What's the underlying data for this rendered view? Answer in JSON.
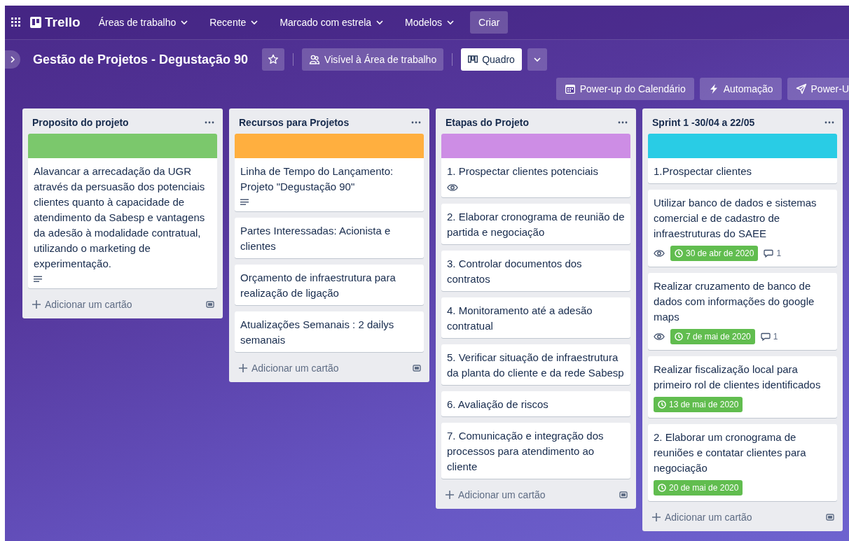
{
  "top_nav": {
    "app_name": "Trello",
    "menus": [
      {
        "label": "Áreas de trabalho"
      },
      {
        "label": "Recente"
      },
      {
        "label": "Marcado com estrela"
      },
      {
        "label": "Modelos"
      }
    ],
    "create_button": "Criar"
  },
  "board": {
    "title": "Gestão de Projetos - Degustação 90",
    "starred": false,
    "visibility": "Visível à Área de trabalho",
    "view": "Quadro"
  },
  "board_actions": [
    {
      "label": "Power-up do Calendário",
      "kind": "calendar"
    },
    {
      "label": "Automação",
      "kind": "automation"
    },
    {
      "label": "Power-U",
      "kind": "powerups"
    }
  ],
  "lists": [
    {
      "title": "Proposito do projeto",
      "add_card": "Adicionar um cartão",
      "cards": [
        {
          "color": "#7bc86c",
          "text": "Alavancar a arrecadação da UGR através da persuasão dos potenciais clientes quanto à capacidade de atendimento da Sabesp e vantagens da adesão à modalidade contratual, utilizando o marketing de experimentação.",
          "watching": false,
          "description": true
        }
      ]
    },
    {
      "title": "Recursos para Projetos",
      "add_card": "Adicionar um cartão",
      "cards": [
        {
          "color": "#ffaf3f",
          "text": "Linha de Tempo do Lançamento: Projeto \"Degustação 90\"",
          "watching": false,
          "description": true
        },
        {
          "text": "Partes Interessadas: Acionista e clientes",
          "watching": false,
          "description": false
        },
        {
          "text": "Orçamento de infraestrutura para realização de ligação",
          "watching": false,
          "description": false
        },
        {
          "text": "Atualizações Semanais : 2 dailys semanais",
          "watching": false,
          "description": false
        }
      ]
    },
    {
      "title": "Etapas do Projeto",
      "add_card": "Adicionar um cartão",
      "cards": [
        {
          "color": "#cd8de5",
          "text": "1. Prospectar clientes potenciais",
          "watching": true,
          "description": false
        },
        {
          "text": "2. Elaborar cronograma de reunião de partida e negociação",
          "watching": false,
          "description": false
        },
        {
          "text": "3. Controlar documentos dos contratos",
          "watching": false,
          "description": false
        },
        {
          "text": "4. Monitoramento até a adesão contratual",
          "watching": false,
          "description": false
        },
        {
          "text": "5. Verificar situação de infraestrutura da planta do cliente e da rede Sabesp",
          "watching": false,
          "description": false
        },
        {
          "text": "6. Avaliação de riscos",
          "watching": false,
          "description": false
        },
        {
          "text": "7. Comunicação e integração dos processos para atendimento ao cliente",
          "watching": false,
          "description": false
        }
      ]
    },
    {
      "title": "Sprint 1 -30/04 a 22/05",
      "add_card": "Adicionar um cartão",
      "cards": [
        {
          "color": "#29cce5",
          "text": "1.Prospectar clientes",
          "watching": false,
          "description": false
        },
        {
          "text": "Utilizar banco de dados e sistemas comercial e de cadastro de infraestruturas do SAEE",
          "watching": true,
          "description": false,
          "due": "30 de abr de 2020",
          "comments": "1"
        },
        {
          "text": "Realizar cruzamento de banco de dados com informações do google maps",
          "watching": true,
          "description": false,
          "due": "7 de mai de 2020",
          "comments": "1"
        },
        {
          "text": "Realizar fiscalização local para primeiro rol de clientes identificados",
          "watching": false,
          "description": false,
          "due": "13 de mai de 2020"
        },
        {
          "text": "2. Elaborar um cronograma de reuniões e contatar clientes para negociação",
          "watching": false,
          "description": false,
          "due": "20 de mai de 2020"
        }
      ]
    }
  ]
}
